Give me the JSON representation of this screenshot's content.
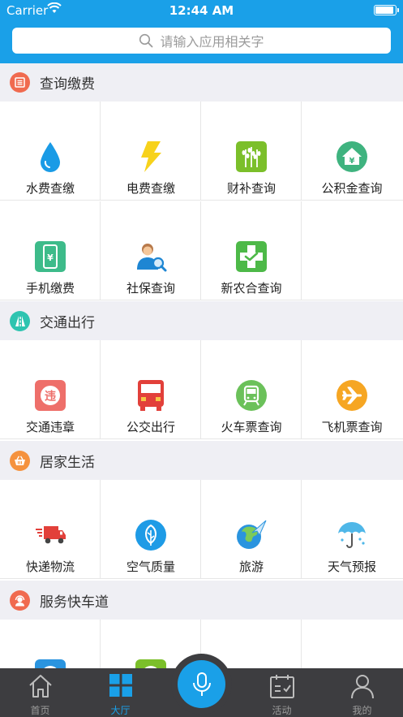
{
  "status_bar": {
    "carrier": "Carrier",
    "time": "12:44 AM"
  },
  "search": {
    "placeholder": "请输入应用相关字"
  },
  "colors": {
    "brand": "#1aa0e8",
    "tabbar": "#3d3d40"
  },
  "sections": [
    {
      "title": "查询缴费",
      "icon": "list-icon",
      "icon_color": "#f06a4f",
      "items": [
        {
          "label": "水费查缴",
          "icon": "water-drop-icon"
        },
        {
          "label": "电费查缴",
          "icon": "lightning-icon"
        },
        {
          "label": "财补查询",
          "icon": "wheat-icon"
        },
        {
          "label": "公积金查询",
          "icon": "house-fund-icon"
        },
        {
          "label": "手机缴费",
          "icon": "phone-yuan-icon"
        },
        {
          "label": "社保查询",
          "icon": "person-search-icon"
        },
        {
          "label": "新农合查询",
          "icon": "medical-cross-icon"
        }
      ]
    },
    {
      "title": "交通出行",
      "icon": "road-icon",
      "icon_color": "#2ec4b0",
      "items": [
        {
          "label": "交通违章",
          "icon": "violation-icon"
        },
        {
          "label": "公交出行",
          "icon": "bus-icon"
        },
        {
          "label": "火车票查询",
          "icon": "train-icon"
        },
        {
          "label": "飞机票查询",
          "icon": "plane-icon"
        }
      ]
    },
    {
      "title": "居家生活",
      "icon": "basket-icon",
      "icon_color": "#f5923e",
      "items": [
        {
          "label": "快递物流",
          "icon": "delivery-truck-icon"
        },
        {
          "label": "空气质量",
          "icon": "leaf-icon"
        },
        {
          "label": "旅游",
          "icon": "globe-plane-icon"
        },
        {
          "label": "天气预报",
          "icon": "umbrella-icon"
        }
      ]
    },
    {
      "title": "服务快车道",
      "icon": "support-agent-icon",
      "icon_color": "#f06a4f",
      "items": []
    }
  ],
  "tabbar": {
    "items": [
      {
        "label": "首页",
        "icon": "home-icon",
        "active": false
      },
      {
        "label": "大厅",
        "icon": "grid-icon",
        "active": true
      },
      {
        "label": "活动",
        "icon": "calendar-icon",
        "active": false
      },
      {
        "label": "我的",
        "icon": "user-icon",
        "active": false
      }
    ],
    "center": {
      "icon": "microphone-icon"
    }
  }
}
